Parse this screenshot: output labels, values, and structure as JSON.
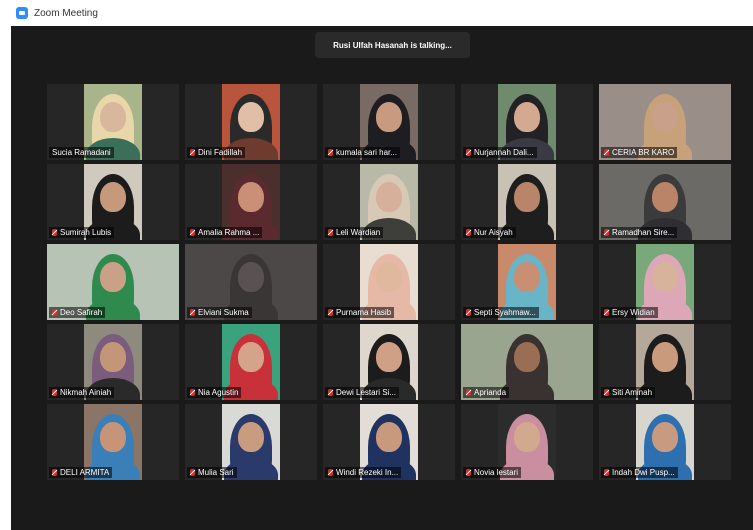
{
  "window": {
    "title": "Zoom Meeting"
  },
  "banner": {
    "talking": "Rusi Ulfah Hasanah is talking..."
  },
  "participants": [
    {
      "name": "Sucia Ramadani",
      "muted": false
    },
    {
      "name": "Dini Fadillah",
      "muted": true
    },
    {
      "name": "kumala sari har...",
      "muted": true
    },
    {
      "name": "Nurjannah Dali...",
      "muted": true
    },
    {
      "name": "CERIA BR KARO",
      "muted": true
    },
    {
      "name": "Sumirah Lubis",
      "muted": true
    },
    {
      "name": "Amalia Rahma ...",
      "muted": true
    },
    {
      "name": "Leli Wardian",
      "muted": true
    },
    {
      "name": "Nur Aisyah",
      "muted": true
    },
    {
      "name": "Ramadhan Sire...",
      "muted": true
    },
    {
      "name": "Deo Safirah",
      "muted": true
    },
    {
      "name": "Elviani Sukma",
      "muted": true
    },
    {
      "name": "Purnama Hasib",
      "muted": true
    },
    {
      "name": "Septi Syahmaw...",
      "muted": true
    },
    {
      "name": "Ersy Widian",
      "muted": true
    },
    {
      "name": "Nikmah Ainiah",
      "muted": true
    },
    {
      "name": "Nia Agustin",
      "muted": true
    },
    {
      "name": "Dewi Lestari Si...",
      "muted": true
    },
    {
      "name": "Aprianda",
      "muted": true
    },
    {
      "name": "Siti Aminah",
      "muted": true
    },
    {
      "name": "DELI ARMITA",
      "muted": true
    },
    {
      "name": "Mulia Sari",
      "muted": true
    },
    {
      "name": "Windi Rezeki In...",
      "muted": true
    },
    {
      "name": "Novia lestari",
      "muted": true
    },
    {
      "name": "Indah Dwi Pusp...",
      "muted": true
    }
  ],
  "colors": {
    "stage": "#1a1a1a",
    "tile": "#262626",
    "muted_mic": "#e02828",
    "app_blue": "#2D8CFF"
  }
}
